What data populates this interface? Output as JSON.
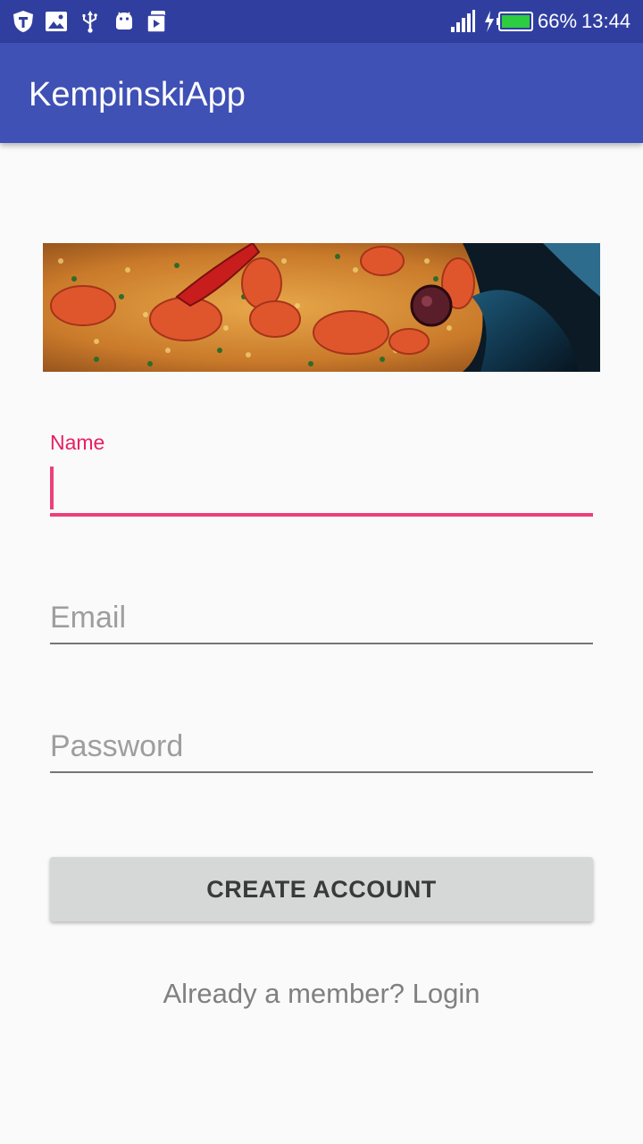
{
  "status_bar": {
    "icons": [
      "shield-icon",
      "image-icon",
      "usb-icon",
      "android-icon",
      "media-icon",
      "signal-icon",
      "battery-charging-icon"
    ],
    "battery": "66%",
    "time": "13:44"
  },
  "app_bar": {
    "title": "KempinskiApp"
  },
  "banner": {
    "icon": "food-banner-image"
  },
  "form": {
    "name": {
      "label": "Name",
      "value": "",
      "placeholder": ""
    },
    "email": {
      "value": "",
      "placeholder": "Email"
    },
    "password": {
      "value": "",
      "placeholder": "Password"
    },
    "create_button_label": "CREATE ACCOUNT",
    "login_link": "Already a member? Login"
  },
  "colors": {
    "status_bar": "#303f9f",
    "app_bar": "#3f51b5",
    "accent": "#ec407a",
    "background": "#fafafa",
    "button": "#d6d7d7"
  }
}
